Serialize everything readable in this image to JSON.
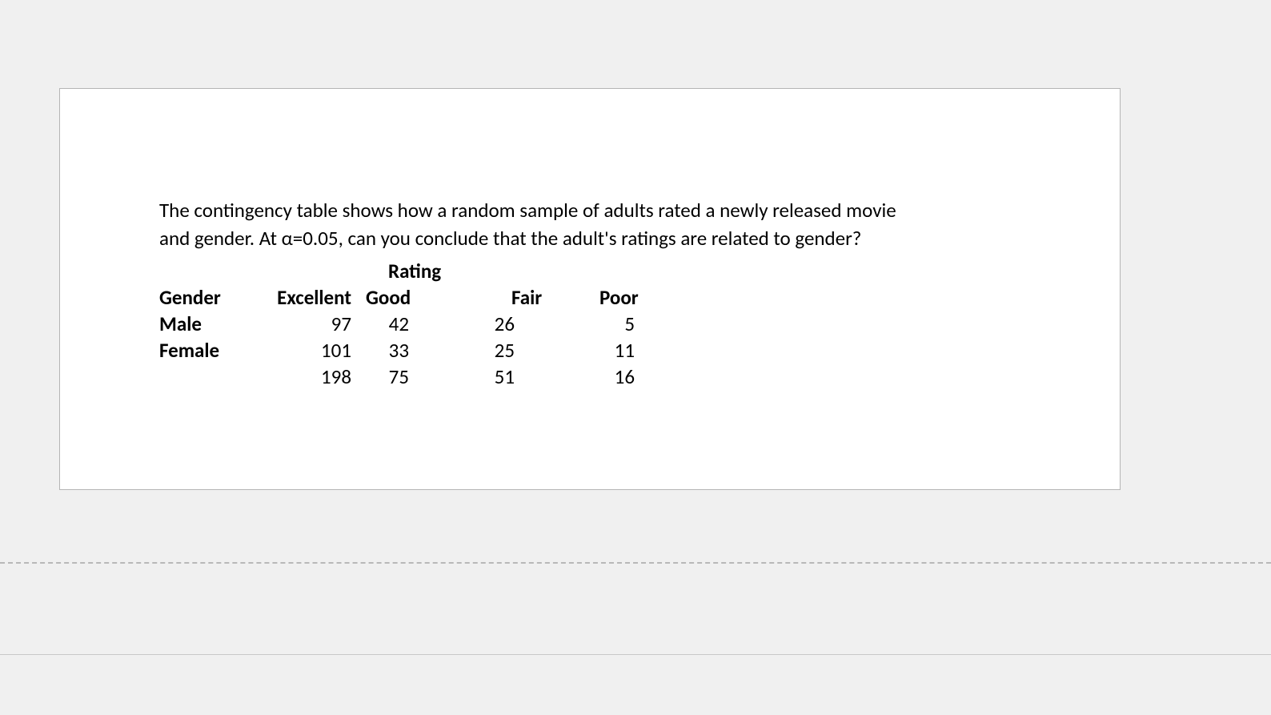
{
  "question": {
    "line1": "The contingency table shows how a random sample of adults rated a newly released movie",
    "line2": "and gender. At α=0.05, can you conclude that the adult's ratings are related to gender?"
  },
  "table": {
    "title": "Rating",
    "headers": {
      "gender": "Gender",
      "excellent": "Excellent",
      "good": "Good",
      "fair": "Fair",
      "poor": "Poor"
    },
    "rows": [
      {
        "gender": "Male",
        "excellent": "97",
        "good": "42",
        "fair": "26",
        "poor": "5"
      },
      {
        "gender": "Female",
        "excellent": "101",
        "good": "33",
        "fair": "25",
        "poor": "11"
      },
      {
        "gender": "",
        "excellent": "198",
        "good": "75",
        "fair": "51",
        "poor": "16"
      }
    ]
  }
}
